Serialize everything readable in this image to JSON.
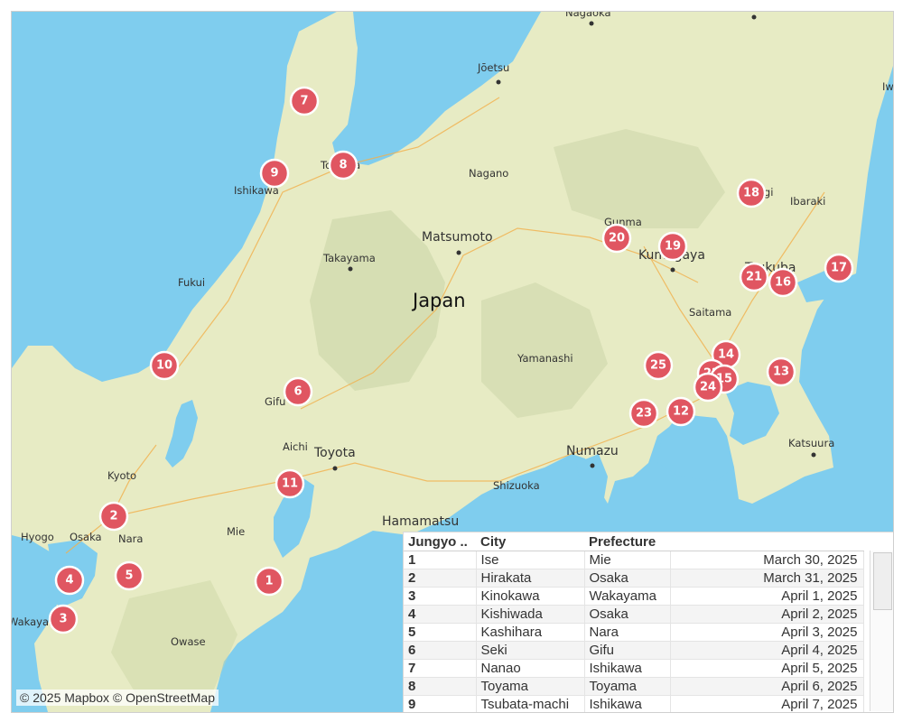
{
  "map": {
    "country": "Japan",
    "water_color": "#7fcdee",
    "land_color": "#e7ebc4",
    "marker_color": "#e05661",
    "places": [
      {
        "id": "nagaoka",
        "name": "Nagaoka"
      },
      {
        "id": "joetsu",
        "name": "Jōetsu"
      },
      {
        "id": "nagano",
        "name": "Nagano"
      },
      {
        "id": "matsumoto",
        "name": "Matsumoto"
      },
      {
        "id": "takayama",
        "name": "Takayama"
      },
      {
        "id": "toyama",
        "name": "Toyama"
      },
      {
        "id": "ishikawa",
        "name": "Ishikawa"
      },
      {
        "id": "fukui",
        "name": "Fukui"
      },
      {
        "id": "gifu",
        "name": "Gifu"
      },
      {
        "id": "aichi",
        "name": "Aichi"
      },
      {
        "id": "toyota",
        "name": "Toyota"
      },
      {
        "id": "kyoto",
        "name": "Kyoto"
      },
      {
        "id": "hyogo",
        "name": "Hyogo"
      },
      {
        "id": "osaka",
        "name": "Osaka"
      },
      {
        "id": "nara",
        "name": "Nara"
      },
      {
        "id": "mie",
        "name": "Mie"
      },
      {
        "id": "wakayama",
        "name": "Wakayama"
      },
      {
        "id": "owase",
        "name": "Owase"
      },
      {
        "id": "hamamatsu",
        "name": "Hamamatsu"
      },
      {
        "id": "shizuoka",
        "name": "Shizuoka"
      },
      {
        "id": "numazu",
        "name": "Numazu"
      },
      {
        "id": "yamanashi",
        "name": "Yamanashi"
      },
      {
        "id": "gunma",
        "name": "Gunma"
      },
      {
        "id": "kumagaya",
        "name": "Kumagaya"
      },
      {
        "id": "saitama",
        "name": "Saitama"
      },
      {
        "id": "tochigi",
        "name": "Tochigi"
      },
      {
        "id": "tsukuba",
        "name": "Tsukuba"
      },
      {
        "id": "ibaraki",
        "name": "Ibaraki"
      },
      {
        "id": "katsuura",
        "name": "Katsuura"
      },
      {
        "id": "iw",
        "name": "Iw"
      }
    ],
    "markers": [
      "1",
      "2",
      "3",
      "4",
      "5",
      "6",
      "7",
      "8",
      "9",
      "10",
      "11",
      "12",
      "13",
      "14",
      "15",
      "16",
      "17",
      "18",
      "19",
      "20",
      "21",
      "22",
      "23",
      "24",
      "25"
    ],
    "attribution": "© 2025 Mapbox © OpenStreetMap"
  },
  "table": {
    "headers": [
      "Jungyo ..",
      "City",
      "Prefecture",
      ""
    ],
    "rows": [
      [
        "1",
        "Ise",
        "Mie",
        "March 30, 2025"
      ],
      [
        "2",
        "Hirakata",
        "Osaka",
        "March 31, 2025"
      ],
      [
        "3",
        "Kinokawa",
        "Wakayama",
        "April 1, 2025"
      ],
      [
        "4",
        "Kishiwada",
        "Osaka",
        "April 2, 2025"
      ],
      [
        "5",
        "Kashihara",
        "Nara",
        "April 3, 2025"
      ],
      [
        "6",
        "Seki",
        "Gifu",
        "April 4, 2025"
      ],
      [
        "7",
        "Nanao",
        "Ishikawa",
        "April 5, 2025"
      ],
      [
        "8",
        "Toyama",
        "Toyama",
        "April 6, 2025"
      ],
      [
        "9",
        "Tsubata-machi",
        "Ishikawa",
        "April 7, 2025"
      ]
    ]
  }
}
